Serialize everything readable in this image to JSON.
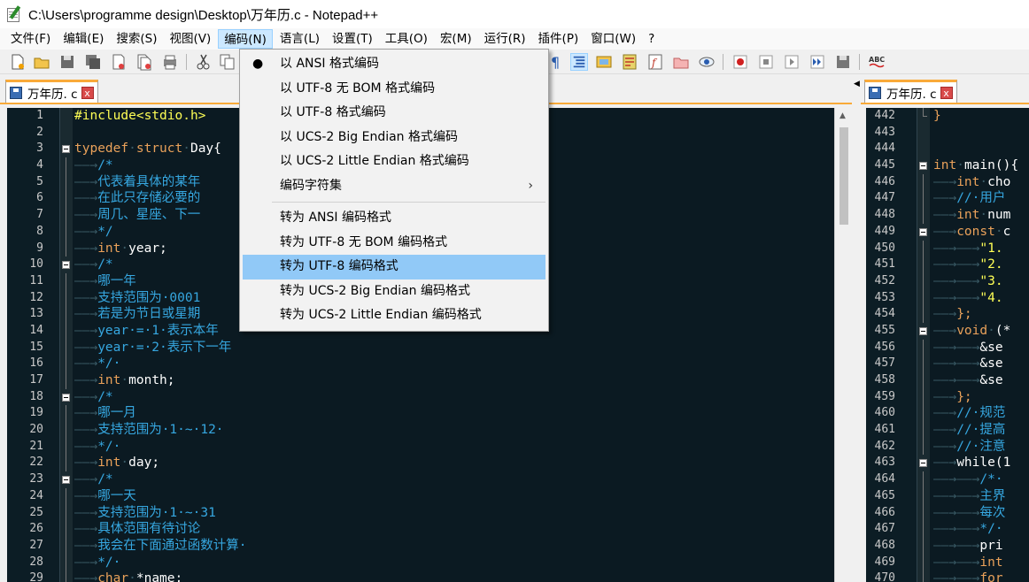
{
  "window": {
    "title": "C:\\Users\\programme design\\Desktop\\万年历.c - Notepad++"
  },
  "menu": [
    {
      "label": "文件(F)"
    },
    {
      "label": "编辑(E)"
    },
    {
      "label": "搜索(S)"
    },
    {
      "label": "视图(V)"
    },
    {
      "label": "编码(N)"
    },
    {
      "label": "语言(L)"
    },
    {
      "label": "设置(T)"
    },
    {
      "label": "工具(O)"
    },
    {
      "label": "宏(M)"
    },
    {
      "label": "运行(R)"
    },
    {
      "label": "插件(P)"
    },
    {
      "label": "窗口(W)"
    },
    {
      "label": "?"
    }
  ],
  "tabs": {
    "left": {
      "label": "万年历. c",
      "close": "x"
    },
    "right": {
      "label": "万年历. c",
      "close": "x"
    }
  },
  "encoding_menu": {
    "selected_mark": "●",
    "submenu_mark": "›",
    "items": [
      "以 ANSI 格式编码",
      "以 UTF-8 无 BOM 格式编码",
      "以 UTF-8 格式编码",
      "以 UCS-2 Big Endian 格式编码",
      "以 UCS-2 Little Endian 格式编码",
      "编码字符集",
      "转为 ANSI 编码格式",
      "转为 UTF-8 无 BOM 编码格式",
      "转为 UTF-8 编码格式",
      "转为 UCS-2 Big Endian 编码格式",
      "转为 UCS-2 Little Endian 编码格式"
    ],
    "highlighted": "转为 UTF-8 编码格式"
  },
  "editor_left": {
    "line_numbers": [
      "1",
      "2",
      "3",
      "4",
      "5",
      "6",
      "7",
      "8",
      "9",
      "10",
      "11",
      "12",
      "13",
      "14",
      "15",
      "16",
      "17",
      "18",
      "19",
      "20",
      "21",
      "22",
      "23",
      "24",
      "25",
      "26",
      "27",
      "28",
      "29"
    ],
    "lines": [
      [
        {
          "t": "#include<stdio.h>",
          "c": "pre"
        }
      ],
      [],
      [
        {
          "t": "typedef",
          "c": "kw"
        },
        {
          "t": "·",
          "c": "tab"
        },
        {
          "t": "struct",
          "c": "kw"
        },
        {
          "t": "·",
          "c": "tab"
        },
        {
          "t": "Day{",
          "c": "id"
        }
      ],
      [
        {
          "t": "——→",
          "c": "tab"
        },
        {
          "t": "/*",
          "c": "cm"
        }
      ],
      [
        {
          "t": "——→",
          "c": "tab"
        },
        {
          "t": "代表着具体的某年",
          "c": "cm"
        }
      ],
      [
        {
          "t": "——→",
          "c": "tab"
        },
        {
          "t": "在此只存储必要的",
          "c": "cm"
        }
      ],
      [
        {
          "t": "——→",
          "c": "tab"
        },
        {
          "t": "周几、星座、下一",
          "c": "cm"
        }
      ],
      [
        {
          "t": "——→",
          "c": "tab"
        },
        {
          "t": "*/",
          "c": "cm"
        }
      ],
      [
        {
          "t": "——→",
          "c": "tab"
        },
        {
          "t": "int",
          "c": "kw"
        },
        {
          "t": "·",
          "c": "tab"
        },
        {
          "t": "year;",
          "c": "id"
        }
      ],
      [
        {
          "t": "——→",
          "c": "tab"
        },
        {
          "t": "/*",
          "c": "cm"
        }
      ],
      [
        {
          "t": "——→",
          "c": "tab"
        },
        {
          "t": "哪一年",
          "c": "cm"
        }
      ],
      [
        {
          "t": "——→",
          "c": "tab"
        },
        {
          "t": "支持范围为·0001",
          "c": "cm"
        }
      ],
      [
        {
          "t": "——→",
          "c": "tab"
        },
        {
          "t": "若是为节日或星期",
          "c": "cm"
        }
      ],
      [
        {
          "t": "——→",
          "c": "tab"
        },
        {
          "t": "year·=·1·表示本年",
          "c": "cm"
        }
      ],
      [
        {
          "t": "——→",
          "c": "tab"
        },
        {
          "t": "year·=·2·表示下一年",
          "c": "cm"
        }
      ],
      [
        {
          "t": "——→",
          "c": "tab"
        },
        {
          "t": "*/·",
          "c": "cm"
        }
      ],
      [
        {
          "t": "——→",
          "c": "tab"
        },
        {
          "t": "int",
          "c": "kw"
        },
        {
          "t": "·",
          "c": "tab"
        },
        {
          "t": "month;",
          "c": "id"
        }
      ],
      [
        {
          "t": "——→",
          "c": "tab"
        },
        {
          "t": "/*",
          "c": "cm"
        }
      ],
      [
        {
          "t": "——→",
          "c": "tab"
        },
        {
          "t": "哪一月",
          "c": "cm"
        }
      ],
      [
        {
          "t": "——→",
          "c": "tab"
        },
        {
          "t": "支持范围为·1·~·12·",
          "c": "cm"
        }
      ],
      [
        {
          "t": "——→",
          "c": "tab"
        },
        {
          "t": "*/·",
          "c": "cm"
        }
      ],
      [
        {
          "t": "——→",
          "c": "tab"
        },
        {
          "t": "int",
          "c": "kw"
        },
        {
          "t": "·",
          "c": "tab"
        },
        {
          "t": "day;",
          "c": "id"
        }
      ],
      [
        {
          "t": "——→",
          "c": "tab"
        },
        {
          "t": "/*",
          "c": "cm"
        }
      ],
      [
        {
          "t": "——→",
          "c": "tab"
        },
        {
          "t": "哪一天",
          "c": "cm"
        }
      ],
      [
        {
          "t": "——→",
          "c": "tab"
        },
        {
          "t": "支持范围为·1·~·31",
          "c": "cm"
        }
      ],
      [
        {
          "t": "——→",
          "c": "tab"
        },
        {
          "t": "具体范围有待讨论",
          "c": "cm"
        }
      ],
      [
        {
          "t": "——→",
          "c": "tab"
        },
        {
          "t": "我会在下面通过函数计算·",
          "c": "cm"
        }
      ],
      [
        {
          "t": "——→",
          "c": "tab"
        },
        {
          "t": "*/·",
          "c": "cm"
        }
      ],
      [
        {
          "t": "——→",
          "c": "tab"
        },
        {
          "t": "char",
          "c": "kw"
        },
        {
          "t": "·",
          "c": "tab"
        },
        {
          "t": "*name;",
          "c": "id"
        }
      ]
    ],
    "folds": [
      "",
      "",
      "box",
      "line",
      "line",
      "line",
      "line",
      "line",
      "line",
      "box",
      "line",
      "line",
      "line",
      "line",
      "line",
      "line",
      "line",
      "box",
      "line",
      "line",
      "line",
      "line",
      "box",
      "line",
      "line",
      "line",
      "line",
      "line",
      "line"
    ]
  },
  "editor_right": {
    "line_numbers": [
      "442",
      "443",
      "444",
      "445",
      "446",
      "447",
      "448",
      "449",
      "450",
      "451",
      "452",
      "453",
      "454",
      "455",
      "456",
      "457",
      "458",
      "459",
      "460",
      "461",
      "462",
      "463",
      "464",
      "465",
      "466",
      "467",
      "468",
      "469",
      "470"
    ],
    "lines": [
      [
        {
          "t": "}",
          "c": "kw"
        }
      ],
      [],
      [],
      [
        {
          "t": "int",
          "c": "kw"
        },
        {
          "t": "·",
          "c": "tab"
        },
        {
          "t": "main(){",
          "c": "id"
        }
      ],
      [
        {
          "t": "——→",
          "c": "tab"
        },
        {
          "t": "int",
          "c": "kw"
        },
        {
          "t": "·",
          "c": "tab"
        },
        {
          "t": "cho",
          "c": "id"
        }
      ],
      [
        {
          "t": "——→",
          "c": "tab"
        },
        {
          "t": "//·用户",
          "c": "cm"
        }
      ],
      [
        {
          "t": "——→",
          "c": "tab"
        },
        {
          "t": "int",
          "c": "kw"
        },
        {
          "t": "·",
          "c": "tab"
        },
        {
          "t": "num",
          "c": "id"
        }
      ],
      [
        {
          "t": "——→",
          "c": "tab"
        },
        {
          "t": "const",
          "c": "kw"
        },
        {
          "t": "·",
          "c": "tab"
        },
        {
          "t": "c",
          "c": "id"
        }
      ],
      [
        {
          "t": "——→——→",
          "c": "tab"
        },
        {
          "t": "\"1.",
          "c": "str"
        }
      ],
      [
        {
          "t": "——→——→",
          "c": "tab"
        },
        {
          "t": "\"2.",
          "c": "str"
        }
      ],
      [
        {
          "t": "——→——→",
          "c": "tab"
        },
        {
          "t": "\"3.",
          "c": "str"
        }
      ],
      [
        {
          "t": "——→——→",
          "c": "tab"
        },
        {
          "t": "\"4.",
          "c": "str"
        }
      ],
      [
        {
          "t": "——→",
          "c": "tab"
        },
        {
          "t": "};",
          "c": "kw"
        }
      ],
      [
        {
          "t": "——→",
          "c": "tab"
        },
        {
          "t": "void",
          "c": "kw"
        },
        {
          "t": "·",
          "c": "tab"
        },
        {
          "t": "(*",
          "c": "id"
        }
      ],
      [
        {
          "t": "——→——→",
          "c": "tab"
        },
        {
          "t": "&se",
          "c": "id"
        }
      ],
      [
        {
          "t": "——→——→",
          "c": "tab"
        },
        {
          "t": "&se",
          "c": "id"
        }
      ],
      [
        {
          "t": "——→——→",
          "c": "tab"
        },
        {
          "t": "&se",
          "c": "id"
        }
      ],
      [
        {
          "t": "——→",
          "c": "tab"
        },
        {
          "t": "};",
          "c": "kw"
        }
      ],
      [
        {
          "t": "——→",
          "c": "tab"
        },
        {
          "t": "//·规范",
          "c": "cm"
        }
      ],
      [
        {
          "t": "——→",
          "c": "tab"
        },
        {
          "t": "//·提高",
          "c": "cm"
        }
      ],
      [
        {
          "t": "——→",
          "c": "tab"
        },
        {
          "t": "//·注意",
          "c": "cm"
        }
      ],
      [
        {
          "t": "——→",
          "c": "tab"
        },
        {
          "t": "while(1",
          "c": "id"
        }
      ],
      [
        {
          "t": "——→——→",
          "c": "tab"
        },
        {
          "t": "/*·",
          "c": "cm"
        }
      ],
      [
        {
          "t": "——→——→",
          "c": "tab"
        },
        {
          "t": "主界",
          "c": "cm"
        }
      ],
      [
        {
          "t": "——→——→",
          "c": "tab"
        },
        {
          "t": "每次",
          "c": "cm"
        }
      ],
      [
        {
          "t": "——→——→",
          "c": "tab"
        },
        {
          "t": "*/·",
          "c": "cm"
        }
      ],
      [
        {
          "t": "——→——→",
          "c": "tab"
        },
        {
          "t": "pri",
          "c": "id"
        }
      ],
      [
        {
          "t": "——→——→",
          "c": "tab"
        },
        {
          "t": "int",
          "c": "kw"
        }
      ],
      [
        {
          "t": "——→——→",
          "c": "tab"
        },
        {
          "t": "for",
          "c": "kw"
        }
      ]
    ],
    "folds": [
      "end",
      "",
      "",
      "box",
      "line",
      "line",
      "line",
      "box",
      "line",
      "line",
      "line",
      "line",
      "line",
      "box",
      "line",
      "line",
      "line",
      "line",
      "line",
      "line",
      "line",
      "box",
      "line",
      "line",
      "line",
      "line",
      "line",
      "line",
      "line"
    ]
  },
  "colors": {
    "editor_bg": "#0b1a22",
    "keyword": "#e9a15a",
    "comment": "#36a7e0",
    "preprocessor": "#ffff55",
    "tab_accent": "#f9aa39",
    "menu_highlight": "#91c9f7"
  }
}
